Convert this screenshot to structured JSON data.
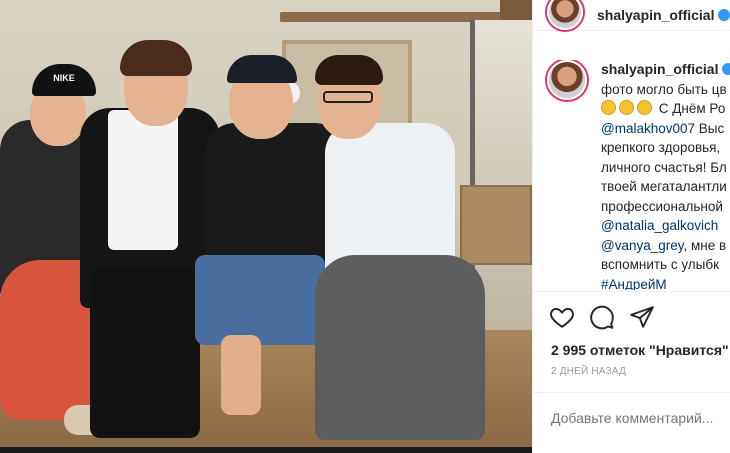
{
  "post": {
    "username": "shalyapin_official",
    "caption_lines": [
      "фото могло быть цв",
      "С Днём Ро",
      "@malakhov007",
      "Выс",
      "крепкого здоровья,",
      "личного счастья! Бл",
      "твоей мегаталантли",
      "профессиональной",
      "@natalia_galkovich",
      "@vanya_grey",
      ", мне в",
      "вспомнить с улыбк",
      "#АндрейМ"
    ],
    "likes_text": "2 995 отметок \"Нравится\"",
    "date_text": "2 ДНЕЙ НАЗАД",
    "comment_placeholder": "Добавьте комментарий...",
    "photo_cap_text": "NIKE"
  },
  "icons": {
    "like": "heart-icon",
    "comment": "comment-bubble-icon",
    "share": "paper-plane-icon",
    "verified": "verified-badge-icon"
  },
  "colors": {
    "accent_link": "#003569",
    "verified": "#3897f0",
    "text": "#262626",
    "muted": "#999999"
  }
}
